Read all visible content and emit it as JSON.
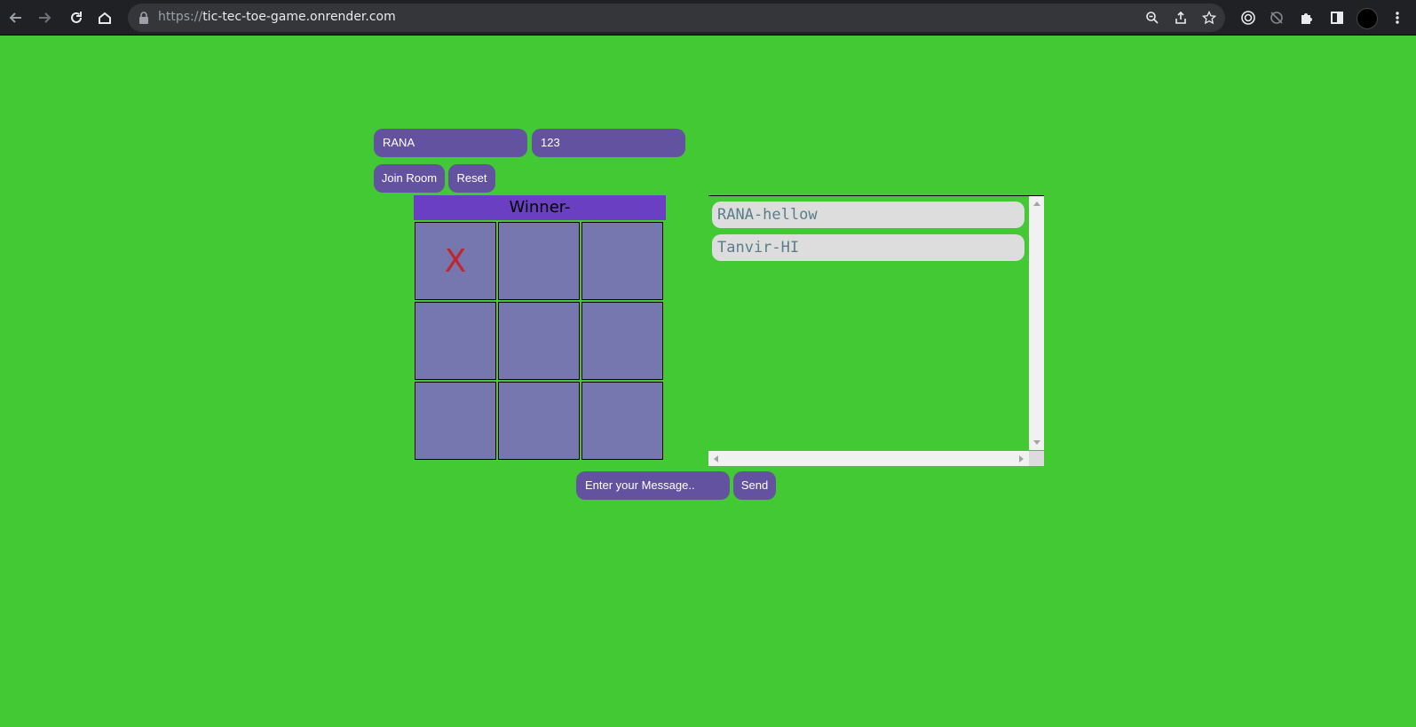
{
  "browser": {
    "url_scheme": "https://",
    "url_host": "tic-tec-toe-game.onrender.com",
    "icons": [
      "back-icon",
      "forward-icon",
      "reload-icon",
      "home-icon",
      "lock-icon",
      "zoom-icon",
      "share-icon",
      "bookmark-star-icon",
      "extension-target-icon",
      "extension-sync-icon",
      "extensions-puzzle-icon",
      "side-panel-icon",
      "profile-avatar",
      "menu-kebab-icon"
    ]
  },
  "form": {
    "name_value": "RANA",
    "room_value": "123",
    "join_label": "Join Room",
    "reset_label": "Reset"
  },
  "game": {
    "winner_label": "Winner-",
    "board": [
      "X",
      "",
      "",
      "",
      "",
      "",
      "",
      "",
      ""
    ]
  },
  "chat": {
    "messages": [
      "RANA-hellow",
      "Tanvir-HI"
    ],
    "input_placeholder": "Enter your Message..",
    "send_label": "Send"
  },
  "colors": {
    "page_background": "#42c933",
    "control_purple": "#6252a0",
    "winner_bar": "#6a3fc1",
    "cell": "#7777b0",
    "x_mark": "#c0262c"
  }
}
